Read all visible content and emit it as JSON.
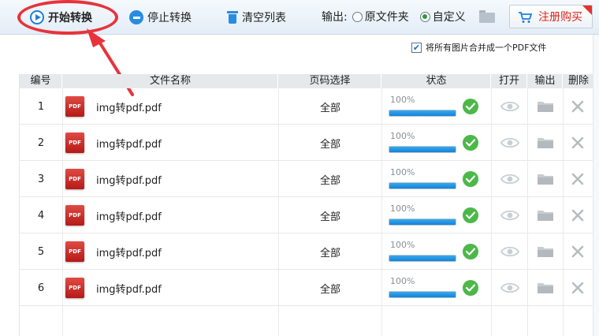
{
  "toolbar": {
    "start_label": "开始转换",
    "stop_label": "停止转换",
    "clear_label": "清空列表",
    "output_label": "输出:",
    "output_options": [
      "原文件夹",
      "自定义"
    ],
    "output_selected": "自定义",
    "buy_label": "注册购买"
  },
  "merge_option": {
    "label": "将所有图片合并成一个PDF文件",
    "checked": true
  },
  "table": {
    "headers": [
      "编号",
      "文件名称",
      "页码选择",
      "状态",
      "打开",
      "输出",
      "删除"
    ],
    "rows": [
      {
        "num": "1",
        "name": "img转pdf.pdf",
        "pages": "全部",
        "progress_text": "100%",
        "progress": 1.0
      },
      {
        "num": "2",
        "name": "img转pdf.pdf",
        "pages": "全部",
        "progress_text": "100%",
        "progress": 1.0
      },
      {
        "num": "3",
        "name": "img转pdf.pdf",
        "pages": "全部",
        "progress_text": "100%",
        "progress": 1.0
      },
      {
        "num": "4",
        "name": "img转pdf.pdf",
        "pages": "全部",
        "progress_text": "100%",
        "progress": 1.0
      },
      {
        "num": "5",
        "name": "img转pdf.pdf",
        "pages": "全部",
        "progress_text": "100%",
        "progress": 1.0
      },
      {
        "num": "6",
        "name": "img转pdf.pdf",
        "pages": "全部",
        "progress_text": "100%",
        "progress": 1.0
      }
    ],
    "file_icon_text": "PDF"
  },
  "colors": {
    "accent": "#2a8ce0",
    "annotation": "#e8333c",
    "success": "#4cb848",
    "buy_text": "#e0241b"
  },
  "icons": {
    "start": "play-circle-icon",
    "stop": "minus-circle-icon",
    "clear": "trash-icon",
    "folder": "folder-icon",
    "cart": "cart-icon",
    "open": "eye-icon",
    "delete": "close-icon",
    "done": "check-circle-icon"
  }
}
